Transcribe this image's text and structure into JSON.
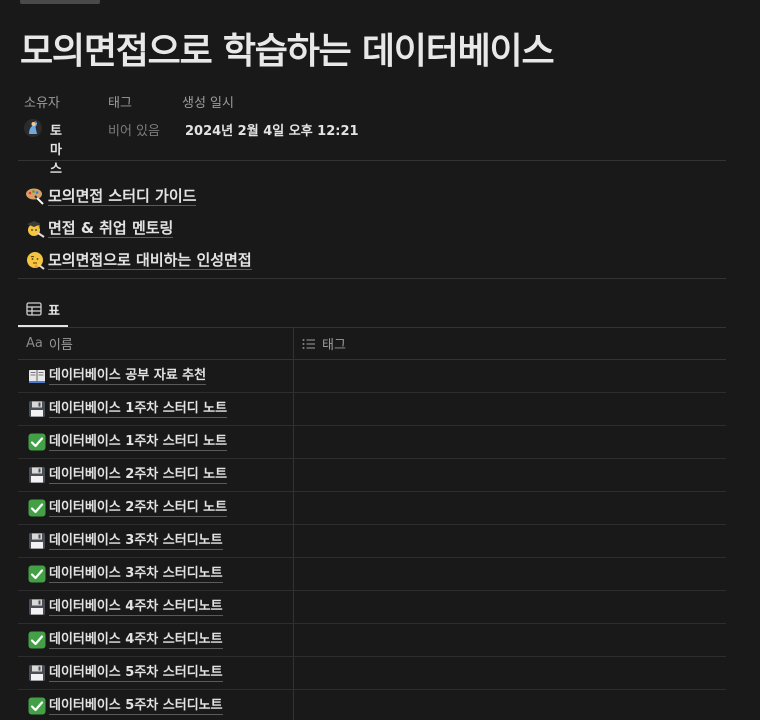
{
  "title": "모의면접으로 학습하는 데이터베이스",
  "properties": {
    "owner_label": "소유자",
    "owner_value": "토마스",
    "tags_label": "태그",
    "tags_value": "비어 있음",
    "created_label": "생성 일시",
    "created_value": "2024년 2월 4일 오후 12:21"
  },
  "links": [
    {
      "icon": "palette-emoji-icon",
      "label": "모의면접 스터디 가이드"
    },
    {
      "icon": "graduate-emoji-icon",
      "label": "면접 & 취업 멘토링"
    },
    {
      "icon": "thinking-emoji-icon",
      "label": "모의면접으로 대비하는 인성면접"
    }
  ],
  "view_tab": {
    "icon": "table-icon",
    "label": "표"
  },
  "table": {
    "columns": [
      {
        "icon": "text-aa-icon",
        "label": "이름",
        "icon_text": "Aa"
      },
      {
        "icon": "list-icon",
        "label": "태그"
      }
    ],
    "rows": [
      {
        "icon": "book-icon",
        "name": "데이터베이스 공부 자료 추천"
      },
      {
        "icon": "floppy-disk-icon",
        "name": "데이터베이스 1주차 스터디 노트"
      },
      {
        "icon": "check-mark-icon",
        "name": "데이터베이스 1주차 스터디 노트"
      },
      {
        "icon": "floppy-disk-icon",
        "name": "데이터베이스 2주차 스터디 노트"
      },
      {
        "icon": "check-mark-icon",
        "name": "데이터베이스 2주차 스터디 노트"
      },
      {
        "icon": "floppy-disk-icon",
        "name": "데이터베이스 3주차 스터디노트"
      },
      {
        "icon": "check-mark-icon",
        "name": "데이터베이스 3주차 스터디노트"
      },
      {
        "icon": "floppy-disk-icon",
        "name": "데이터베이스 4주차 스터디노트"
      },
      {
        "icon": "check-mark-icon",
        "name": "데이터베이스 4주차 스터디노트"
      },
      {
        "icon": "floppy-disk-icon",
        "name": "데이터베이스 5주차 스터디노트"
      },
      {
        "icon": "check-mark-icon",
        "name": "데이터베이스 5주차 스터디노트"
      }
    ]
  }
}
